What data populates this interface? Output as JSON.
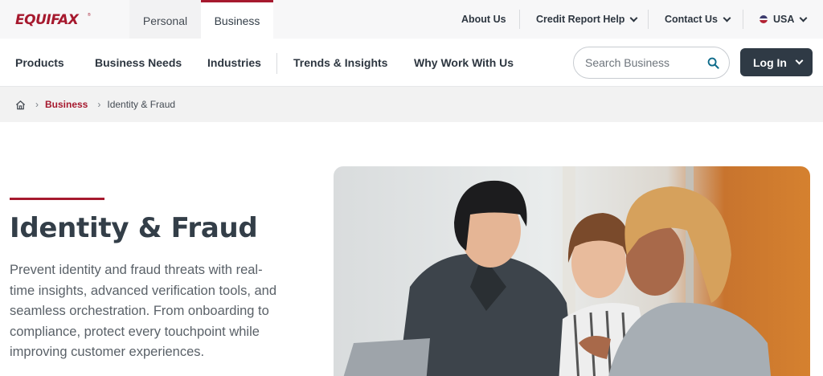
{
  "brand": {
    "logo_text": "EQUIFAX",
    "trademark": "®",
    "color": "#a6192e"
  },
  "site_tabs": [
    {
      "label": "Personal",
      "active": false
    },
    {
      "label": "Business",
      "active": true
    }
  ],
  "utility_nav": {
    "about": "About Us",
    "credit_help": "Credit Report Help",
    "contact": "Contact Us",
    "country": "USA"
  },
  "main_nav": {
    "items": [
      "Products",
      "Business Needs",
      "Industries",
      "Trends & Insights",
      "Why Work With Us"
    ],
    "search_placeholder": "Search Business",
    "login_label": "Log In"
  },
  "breadcrumb": {
    "home_icon": "home-icon",
    "parent": "Business",
    "current": "Identity & Fraud"
  },
  "hero": {
    "title": "Identity & Fraud",
    "body": "Prevent identity and fraud threats with real-time insights, advanced verification tools, and seamless orchestration. From onboarding to compliance, protect every touchpoint while improving customer experiences."
  },
  "colors": {
    "accent": "#a6192e",
    "dark": "#2f3a45",
    "search_icon": "#0e6b8a"
  }
}
